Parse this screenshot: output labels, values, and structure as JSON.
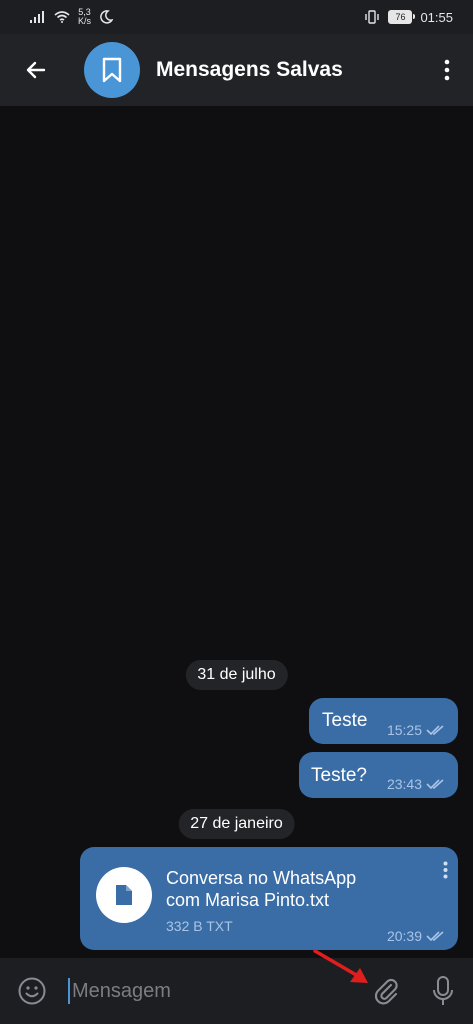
{
  "status_bar": {
    "network_speed_value": "5,3",
    "network_speed_unit": "K/s",
    "battery": "76",
    "time": "01:55",
    "icons": [
      "signal-icon",
      "wifi-icon",
      "moon-icon",
      "vibrate-icon",
      "battery-icon"
    ]
  },
  "header": {
    "title": "Mensagens Salvas",
    "icons": [
      "back-arrow-icon",
      "bookmark-icon",
      "more-vert-icon"
    ],
    "avatar_color": "#4a95d6"
  },
  "messages": [
    {
      "type": "date",
      "label": "31 de julho"
    },
    {
      "type": "text",
      "text": "Teste",
      "time": "15:25",
      "status": "read"
    },
    {
      "type": "text",
      "text": "Teste?",
      "time": "23:43",
      "status": "read"
    },
    {
      "type": "date",
      "label": "27 de janeiro"
    },
    {
      "type": "file",
      "name": "Conversa no WhatsApp com Marisa Pinto.txt",
      "size": "332 B TXT",
      "time": "20:39",
      "status": "read"
    }
  ],
  "input_bar": {
    "placeholder": "Mensagem",
    "icons": [
      "emoji-icon",
      "attach-icon",
      "mic-icon"
    ]
  },
  "colors": {
    "bubble": "#3a6ca6",
    "accent": "#4a95d6",
    "annotation_arrow": "#e01e1e"
  }
}
